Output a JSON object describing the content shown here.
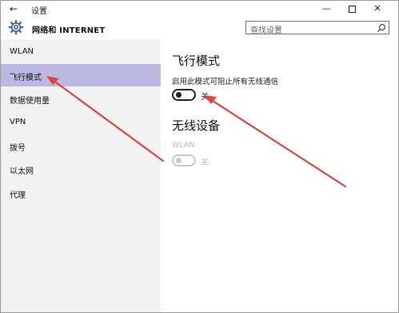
{
  "window": {
    "title": "设置",
    "back_glyph": "←",
    "min_glyph": "—",
    "close_glyph": "✕"
  },
  "header": {
    "app_title": "网络和 INTERNET",
    "search_placeholder": "查找设置"
  },
  "sidebar": {
    "items": [
      {
        "label": "WLAN",
        "selected": false
      },
      {
        "label": "飞行模式",
        "selected": true
      },
      {
        "label": "数据使用量",
        "selected": false
      },
      {
        "label": "VPN",
        "selected": false
      },
      {
        "label": "拨号",
        "selected": false
      },
      {
        "label": "以太网",
        "selected": false
      },
      {
        "label": "代理",
        "selected": false
      }
    ]
  },
  "main": {
    "airplane": {
      "heading": "飞行模式",
      "description": "启用此模式可阻止所有无线通信",
      "toggle_state": "关",
      "toggle_on": false
    },
    "wireless": {
      "heading": "无线设备",
      "wlan_label": "WLAN",
      "toggle_state": "关",
      "toggle_on": false,
      "disabled": true
    }
  },
  "colors": {
    "selected_nav": "#bcb8e4",
    "sidebar_bg": "#f2f2f2",
    "annotation_arrow": "#e8413c",
    "gear_icon": "#3a62b0"
  }
}
